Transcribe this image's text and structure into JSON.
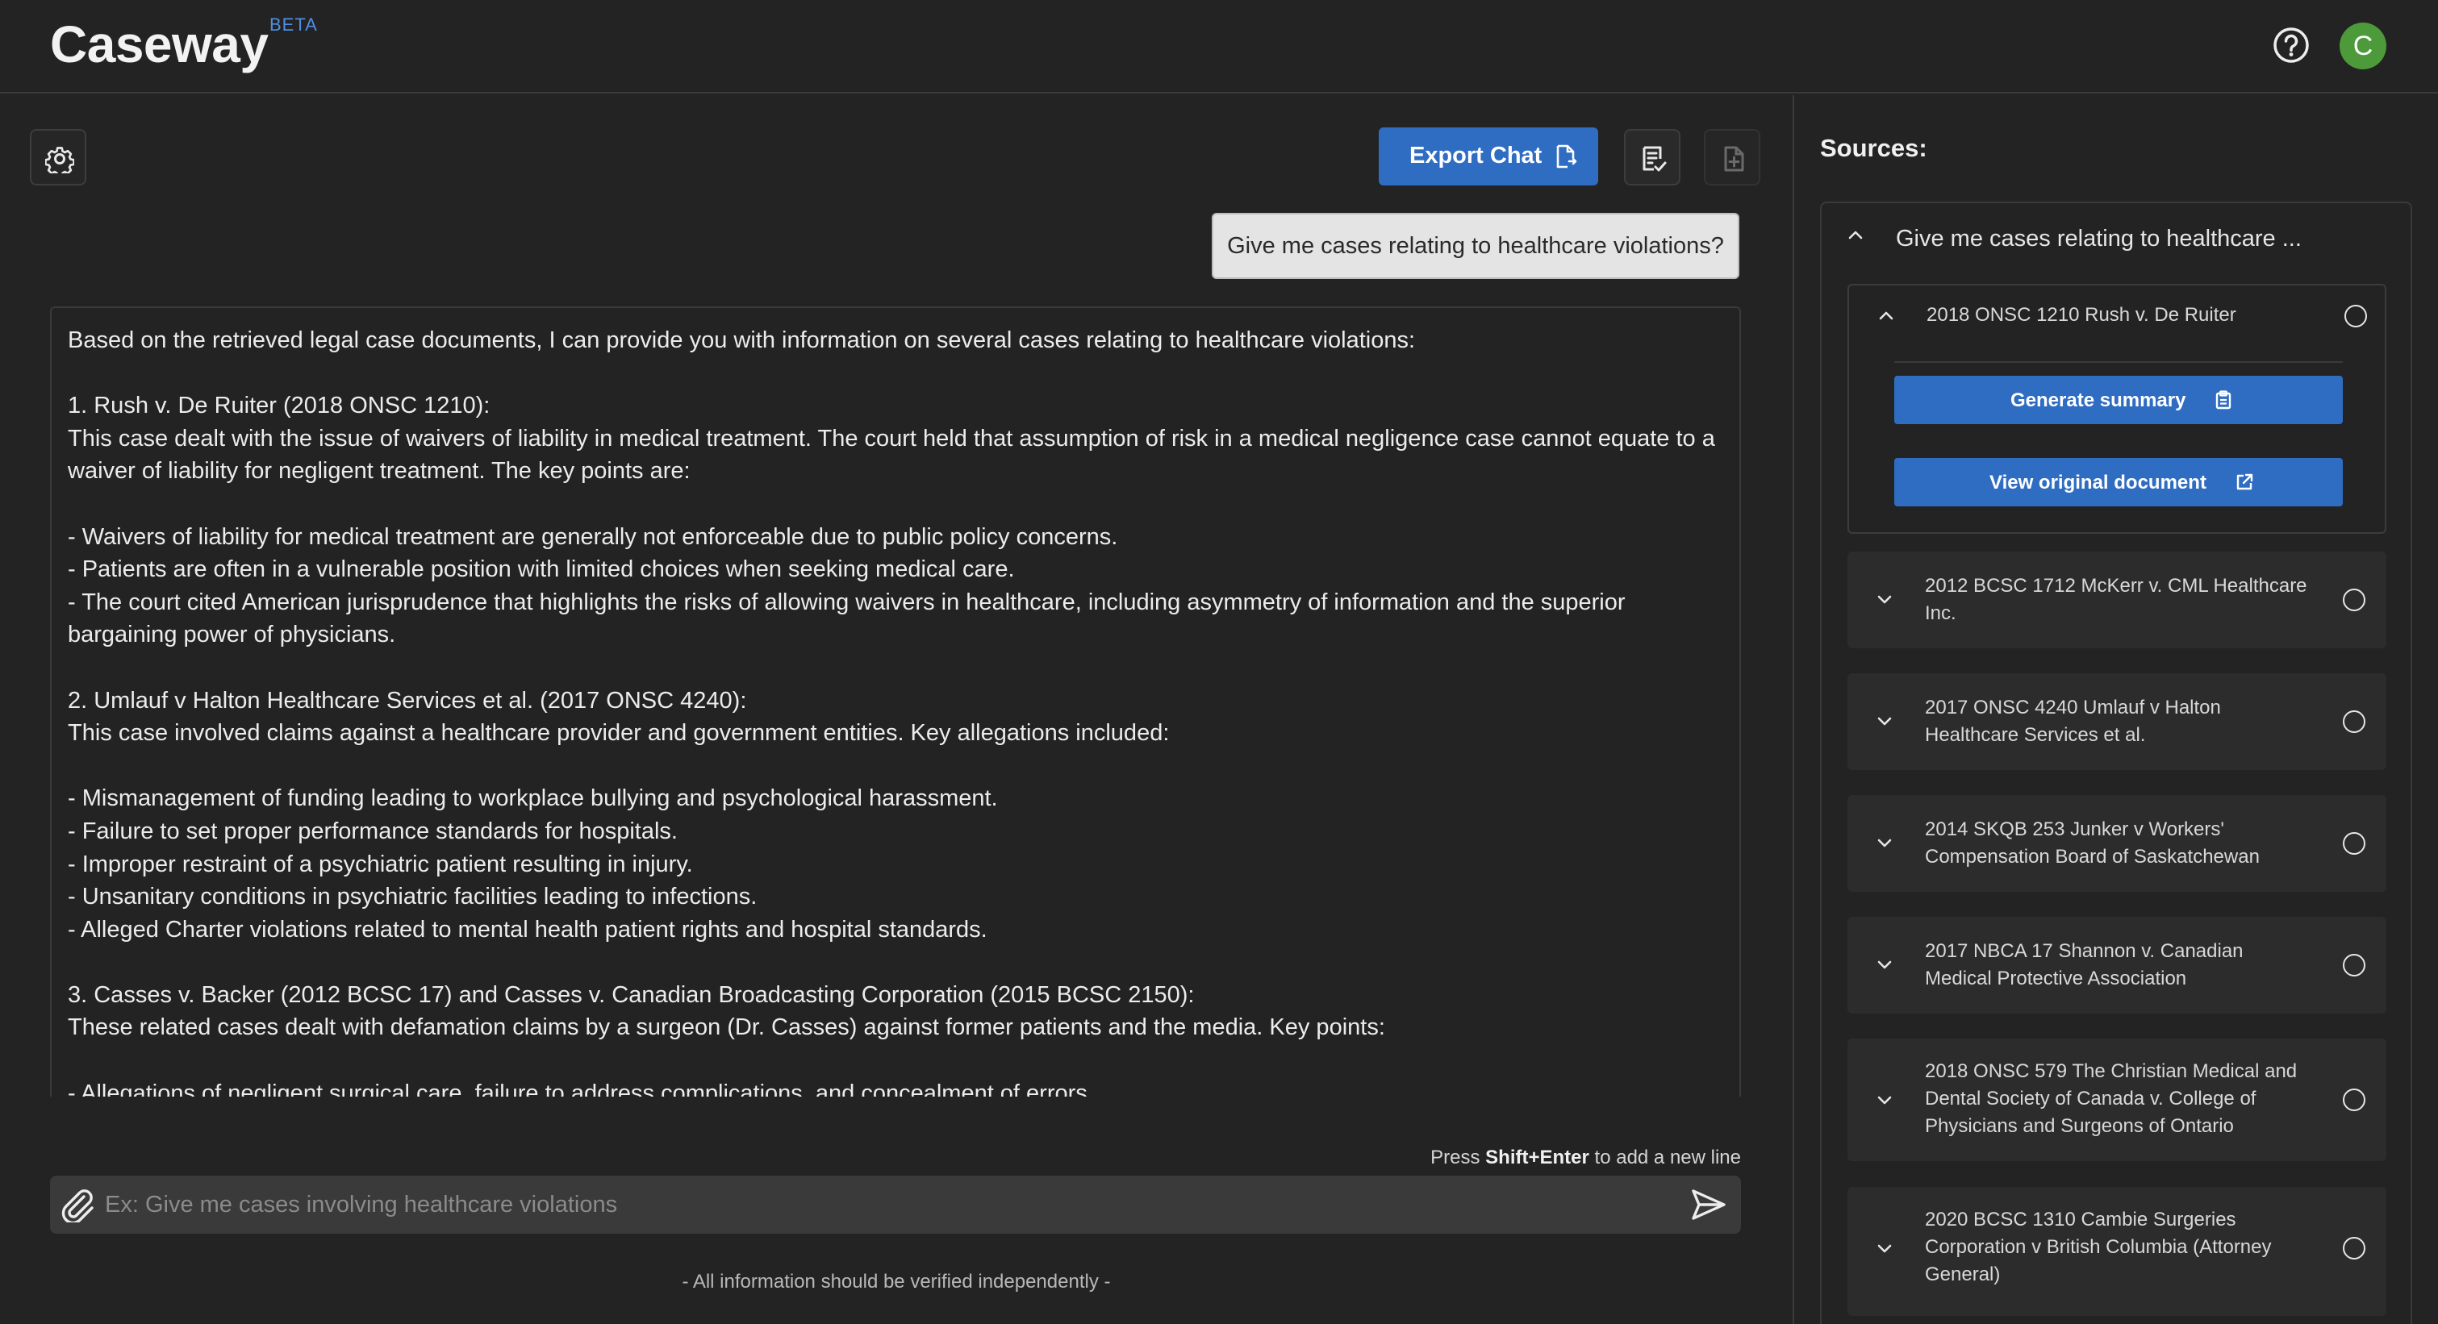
{
  "app": {
    "title": "Caseway",
    "badge": "BETA",
    "avatar_initial": "C"
  },
  "toolbar": {
    "export_label": "Export Chat"
  },
  "chat": {
    "user_message": "Give me cases relating to healthcare violations?",
    "assistant_message": "Based on the retrieved legal case documents, I can provide you with information on several cases relating to healthcare violations:\n\n1. Rush v. De Ruiter (2018 ONSC 1210):\nThis case dealt with the issue of waivers of liability in medical treatment. The court held that assumption of risk in a medical negligence case cannot equate to a waiver of liability for negligent treatment. The key points are:\n\n- Waivers of liability for medical treatment are generally not enforceable due to public policy concerns.\n- Patients are often in a vulnerable position with limited choices when seeking medical care.\n- The court cited American jurisprudence that highlights the risks of allowing waivers in healthcare, including asymmetry of information and the superior bargaining power of physicians.\n\n2. Umlauf v Halton Healthcare Services et al. (2017 ONSC 4240):\nThis case involved claims against a healthcare provider and government entities. Key allegations included:\n\n- Mismanagement of funding leading to workplace bullying and psychological harassment.\n- Failure to set proper performance standards for hospitals.\n- Improper restraint of a psychiatric patient resulting in injury.\n- Unsanitary conditions in psychiatric facilities leading to infections.\n- Alleged Charter violations related to mental health patient rights and hospital standards.\n\n3. Casses v. Backer (2012 BCSC 17) and Casses v. Canadian Broadcasting Corporation (2015 BCSC 2150):\nThese related cases dealt with defamation claims by a surgeon (Dr. Casses) against former patients and the media. Key points:\n\n- Allegations of negligent surgical care, failure to address complications, and concealment of errors."
  },
  "composer": {
    "hint_prefix": "Press",
    "hint_key": "Shift+Enter",
    "hint_suffix": "to add a new line",
    "placeholder": "Ex: Give me cases involving healthcare violations",
    "disclaimer": "- All information should be verified independently -"
  },
  "sources": {
    "title": "Sources:",
    "query": "Give me cases relating to healthcare ...",
    "items": [
      {
        "title": "2018 ONSC 1210 Rush v. De Ruiter",
        "expanded": true,
        "summary_label": "Generate summary",
        "view_label": "View original document"
      },
      {
        "title": "2012 BCSC 1712 McKerr v. CML Healthcare Inc.",
        "expanded": false
      },
      {
        "title": "2017 ONSC 4240 Umlauf v Halton Healthcare Services et al.",
        "expanded": false
      },
      {
        "title": "2014 SKQB 253 Junker v Workers' Compensation Board of Saskatchewan",
        "expanded": false
      },
      {
        "title": "2017 NBCA 17 Shannon v. Canadian Medical Protective Association",
        "expanded": false
      },
      {
        "title": "2018 ONSC 579 The Christian Medical and Dental Society of Canada v. College of Physicians and Surgeons of Ontario",
        "expanded": false
      },
      {
        "title": "2020 BCSC 1310 Cambie Surgeries Corporation v British Columbia (Attorney General)",
        "expanded": false
      }
    ]
  },
  "colors": {
    "accent": "#2f6dc2",
    "beta": "#4f8ee6",
    "avatar": "#4d9a3a",
    "background": "#232323"
  },
  "icons": [
    "help-icon",
    "settings-icon",
    "export-icon",
    "review-icon",
    "new-document-icon",
    "paperclip-icon",
    "send-icon",
    "chevron-up-icon",
    "chevron-down-icon",
    "clipboard-icon",
    "external-link-icon",
    "radio-icon"
  ]
}
